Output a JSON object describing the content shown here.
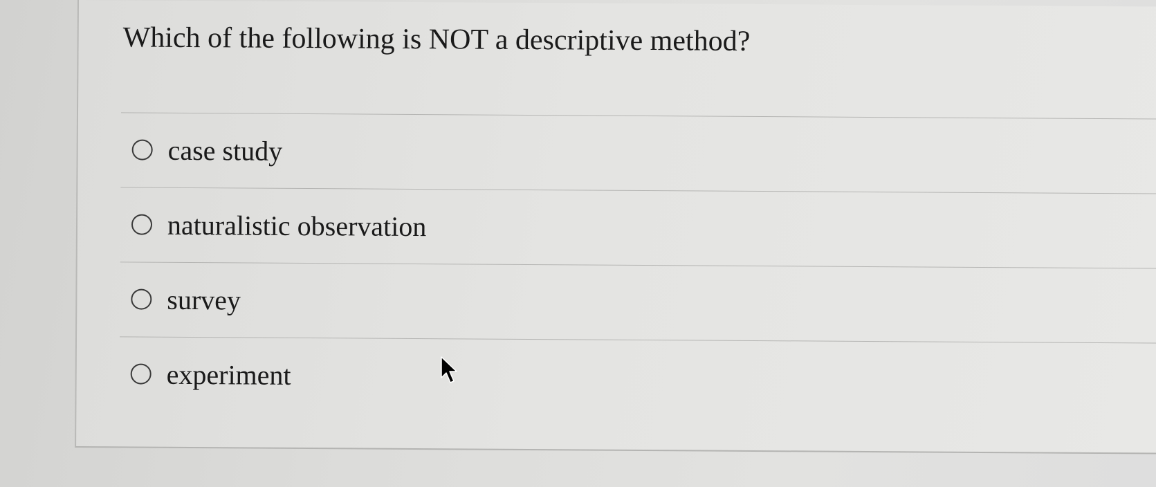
{
  "question": {
    "text": "Which of the following is NOT a descriptive method?"
  },
  "options": [
    {
      "label": "case study",
      "selected": false
    },
    {
      "label": "naturalistic observation",
      "selected": false
    },
    {
      "label": "survey",
      "selected": false
    },
    {
      "label": "experiment",
      "selected": false
    }
  ],
  "cursor": {
    "icon": "mouse-pointer-icon"
  }
}
